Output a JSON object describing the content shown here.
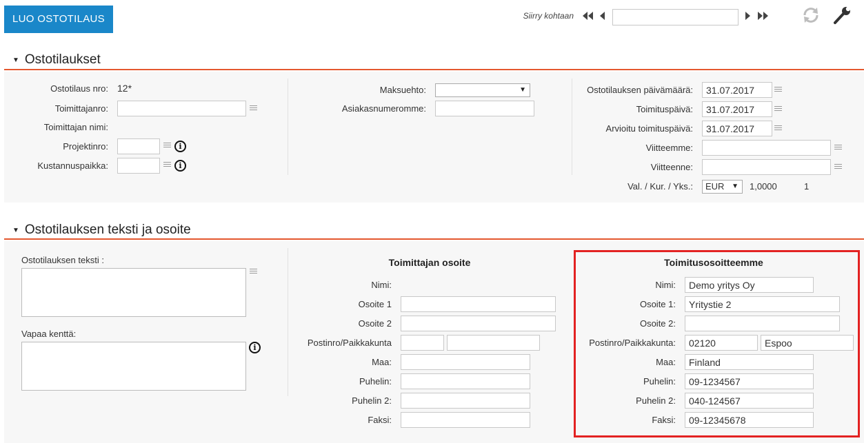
{
  "toolbar": {
    "create_button": "LUO OSTOTILAUS",
    "goto_label": "Siirry kohtaan",
    "goto_value": "",
    "first_icon": "double-chevron-left-icon",
    "prev_icon": "chevron-left-icon",
    "next_icon": "chevron-right-icon",
    "last_icon": "double-chevron-right-icon",
    "refresh_icon": "refresh-icon",
    "settings_icon": "wrench-icon"
  },
  "colors": {
    "accent": "#e4572e",
    "button": "#1a87c9",
    "highlight": "#e32222"
  },
  "orders": {
    "title": "Ostotilaukset",
    "order_no_label": "Ostotilaus nro:",
    "order_no_value": "12*",
    "supplier_no_label": "Toimittajanro:",
    "supplier_no_value": "",
    "supplier_name_label": "Toimittajan nimi:",
    "project_no_label": "Projektinro:",
    "project_no_value": "",
    "cost_center_label": "Kustannuspaikka:",
    "cost_center_value": "",
    "payment_terms_label": "Maksuehto:",
    "payment_terms_value": "",
    "customer_no_label": "Asiakasnumeromme:",
    "customer_no_value": "",
    "order_date_label": "Ostotilauksen päivämäärä:",
    "order_date_value": "31.07.2017",
    "delivery_date_label": "Toimituspäivä:",
    "delivery_date_value": "31.07.2017",
    "estimated_date_label": "Arvioitu toimituspäivä:",
    "estimated_date_value": "31.07.2017",
    "our_ref_label": "Viitteemme:",
    "our_ref_value": "",
    "your_ref_label": "Viitteenne:",
    "your_ref_value": "",
    "currency_label": "Val. / Kur. / Yks.:",
    "currency_value": "EUR",
    "rate_value": "1,0000",
    "unit_value": "1"
  },
  "texts": {
    "title": "Ostotilauksen teksti ja osoite",
    "order_text_label": "Ostotilauksen teksti :",
    "order_text_value": "",
    "free_field_label": "Vapaa kenttä:",
    "free_field_value": ""
  },
  "supplier_address": {
    "title": "Toimittajan osoite",
    "name_label": "Nimi:",
    "address1_label": "Osoite 1",
    "address1_value": "",
    "address2_label": "Osoite 2",
    "address2_value": "",
    "postal_label": "Postinro/Paikkakunta",
    "postal_value": "",
    "city_value": "",
    "country_label": "Maa:",
    "country_value": "",
    "phone_label": "Puhelin:",
    "phone_value": "",
    "phone2_label": "Puhelin 2:",
    "phone2_value": "",
    "fax_label": "Faksi:",
    "fax_value": ""
  },
  "delivery_address": {
    "title": "Toimitusosoitteemme",
    "name_label": "Nimi:",
    "name_value": "Demo yritys Oy",
    "address1_label": "Osoite 1:",
    "address1_value": "Yritystie 2",
    "address2_label": "Osoite 2:",
    "address2_value": "",
    "postal_label": "Postinro/Paikkakunta:",
    "postal_value": "02120",
    "city_value": "Espoo",
    "country_label": "Maa:",
    "country_value": "Finland",
    "phone_label": "Puhelin:",
    "phone_value": "09-1234567",
    "phone2_label": "Puhelin 2:",
    "phone2_value": "040-124567",
    "fax_label": "Faksi:",
    "fax_value": "09-12345678"
  }
}
